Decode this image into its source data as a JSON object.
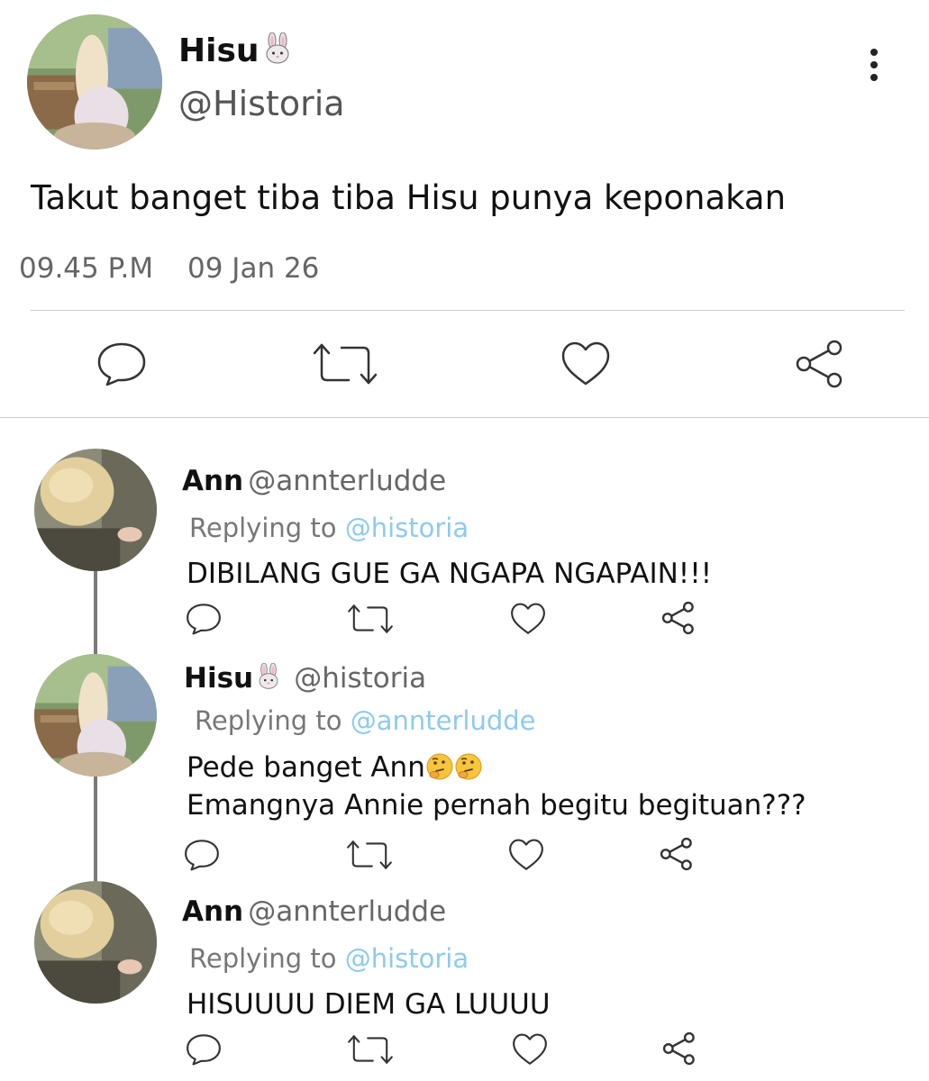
{
  "main_tweet": {
    "display_name": "Hisu",
    "name_emoji": "rabbit-face-emoji",
    "handle": "@Historia",
    "text": "Takut banget tiba tiba Hisu punya keponakan",
    "time": "09.45 P.M",
    "date": "09 Jan 26",
    "actions": [
      "reply-icon",
      "retweet-icon",
      "like-icon",
      "share-icon"
    ]
  },
  "replies": [
    {
      "display_name": "Ann",
      "handle": "@annterludde",
      "replying_label": "Replying to",
      "replying_to": "@historia",
      "text": "DIBILANG GUE GA NGAPA NGAPAIN!!!"
    },
    {
      "display_name": "Hisu",
      "name_emoji": "rabbit-face-emoji",
      "handle": "@historia",
      "replying_label": "Replying to",
      "replying_to": "@annterludde",
      "text_line1": "Pede banget Ann",
      "text_line1_emoji": "thinking-face-emoji x2",
      "text_line2": "Emangnya Annie pernah begitu begituan???"
    },
    {
      "display_name": "Ann",
      "handle": "@annterludde",
      "replying_label": "Replying to",
      "replying_to": "@historia",
      "text": "HISUUUU DIEM GA LUUUU"
    }
  ],
  "colors": {
    "mention": "#8ecaf0",
    "text": "#111111",
    "secondary": "#666666",
    "divider": "#cccccc"
  }
}
